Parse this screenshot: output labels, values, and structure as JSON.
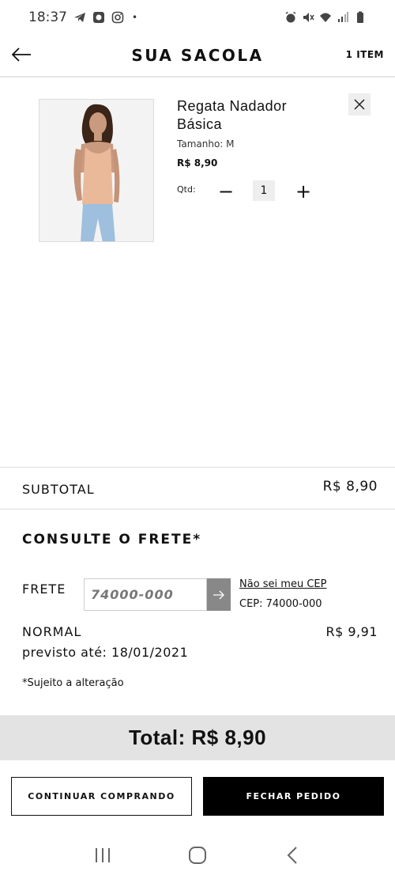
{
  "status_bar": {
    "time": "18:37",
    "dot": "•"
  },
  "header": {
    "title": "SUA SACOLA",
    "item_count": "1 ITEM"
  },
  "product": {
    "name": "Regata Nadador Básica",
    "size": "Tamanho: M",
    "price": "R$ 8,90",
    "qty_label": "Qtd:",
    "qty_value": "1",
    "minus_glyph": "−",
    "plus_glyph": "+"
  },
  "subtotal": {
    "label": "SUBTOTAL",
    "value": "R$ 8,90"
  },
  "freight": {
    "title": "CONSULTE O FRETE*",
    "field_label": "FRETE",
    "cep_value": "74000-000",
    "link": "Não sei meu CEP",
    "cep_current": "CEP: 74000-000",
    "option_name": "NORMAL",
    "option_price": "R$ 9,91",
    "estimate": "previsto até: 18/01/2021",
    "disclaimer": "*Sujeito a alteração"
  },
  "total": {
    "text": "Total: R$ 8,90"
  },
  "actions": {
    "continue": "CONTINUAR COMPRANDO",
    "checkout": "FECHAR PEDIDO"
  },
  "icons": {
    "back": "arrow-left-icon",
    "remove": "close-icon",
    "submit": "arrow-right-icon",
    "nav_recent": "recent-apps-icon",
    "nav_home": "home-icon",
    "nav_back": "back-icon"
  },
  "colors": {
    "total_bar": "#e3e3e3",
    "checkout_bg": "#000000",
    "submit_bg": "#888888"
  }
}
